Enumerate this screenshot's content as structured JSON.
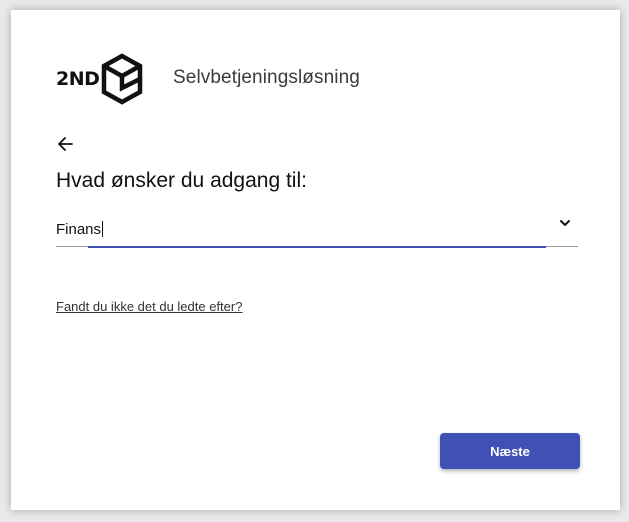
{
  "header": {
    "logo_text": "2ND",
    "app_title": "Selvbetjeningsløsning"
  },
  "form": {
    "back_icon": "arrow-left-icon",
    "heading": "Hvad ønsker du adgang til:",
    "access_select": {
      "value": "Finans",
      "icon": "chevron-down-icon"
    },
    "help_link": "Fandt du ikke det du ledte efter?",
    "next_label": "Næste"
  },
  "colors": {
    "primary": "#3f51b5",
    "focus_underline": "#3f4db5",
    "background": "#e9e9e9",
    "card": "#ffffff"
  }
}
